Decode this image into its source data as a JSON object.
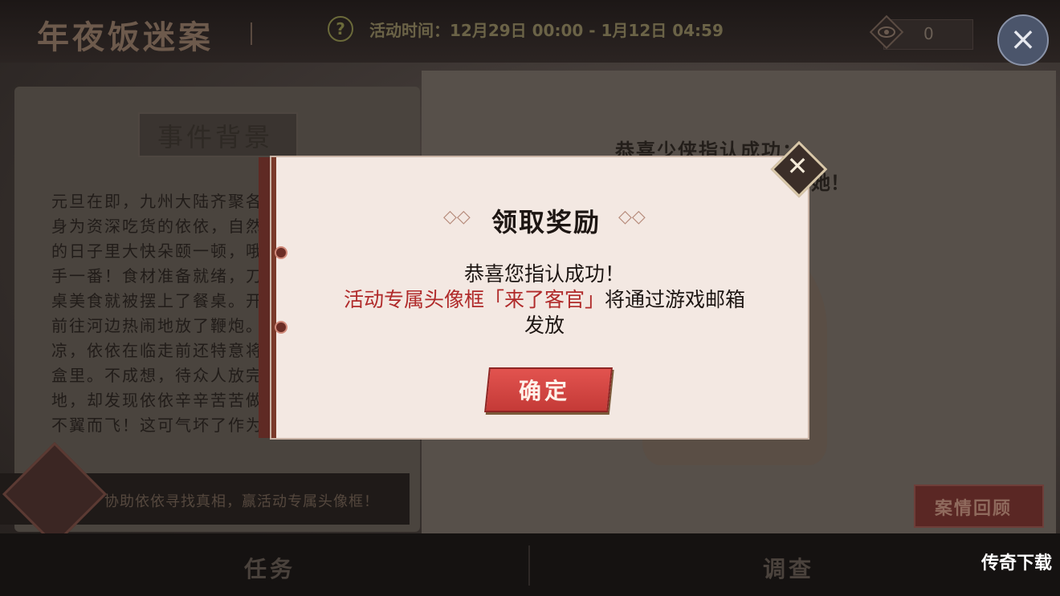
{
  "header": {
    "title": "年夜饭迷案",
    "help_icon": "?",
    "event_time": "活动时间：12月29日  00:00  -  1月12日  04:59",
    "counter": "0",
    "close_icon": "×"
  },
  "notebook": {
    "section_title": "事件背景",
    "story_lines": [
      "元旦在即，九州大陆齐聚各",
      "身为资深吃货的依依，自然",
      "的日子里大快朵颐一顿，哦",
      "手一番！食材准备就绪，刀",
      "桌美食就被摆上了餐桌。开",
      "前往河边热闹地放了鞭炮。",
      "凉，依依在临走前还特意将",
      "盒里。不成想，待众人放完",
      "地，却发现依依辛辛苦苦做",
      "不翼而飞！这可气坏了作为"
    ],
    "mission_text": "协助依依寻找真相，赢活动专属头像框！"
  },
  "right_page": {
    "congrats_line": "恭喜少侠指认成功：",
    "congrats_tail": "她！",
    "review_button": "案情回顾"
  },
  "bottom_nav": {
    "tab_task": "任务",
    "tab_investigate": "调查"
  },
  "watermark": "传奇下载",
  "modal": {
    "title": "领取奖励",
    "ornament_left": "◇◇",
    "ornament_right": "◇◇",
    "close_icon": "✕",
    "line1": "恭喜您指认成功！",
    "line2_red": "活动专属头像框「来了客官」",
    "line2_rest": "将通过游戏邮箱",
    "line3": "发放",
    "confirm_button": "确定"
  },
  "colors": {
    "accent_red": "#b02a2a",
    "button_red": "#d8463f",
    "modal_bg": "#f3e8e2"
  }
}
